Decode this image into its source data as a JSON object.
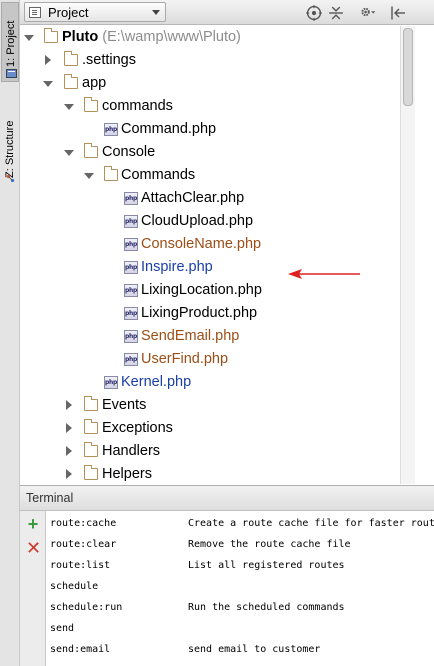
{
  "sidebar": {
    "tabs": [
      {
        "label": "1: Project"
      },
      {
        "label": "Z: Structure"
      }
    ]
  },
  "header": {
    "select_label": "Project",
    "icons": [
      "target-icon",
      "collapse-icon",
      "gear-icon",
      "hide-panel-icon"
    ]
  },
  "tree": {
    "root": {
      "name": "Pluto",
      "path": "(E:\\wamp\\www\\Pluto)"
    },
    "items": [
      {
        "name": ".settings"
      },
      {
        "name": "app"
      },
      {
        "name": "commands"
      },
      {
        "name": "Command.php"
      },
      {
        "name": "Console"
      },
      {
        "name": "Commands"
      },
      {
        "name": "AttachClear.php"
      },
      {
        "name": "CloudUpload.php"
      },
      {
        "name": "ConsoleName.php"
      },
      {
        "name": "Inspire.php"
      },
      {
        "name": "LixingLocation.php"
      },
      {
        "name": "LixingProduct.php"
      },
      {
        "name": "SendEmail.php"
      },
      {
        "name": "UserFind.php"
      },
      {
        "name": "Kernel.php"
      },
      {
        "name": "Events"
      },
      {
        "name": "Exceptions"
      },
      {
        "name": "Handlers"
      },
      {
        "name": "Helpers"
      }
    ]
  },
  "colors": {
    "modified_orange": "#9c4e16",
    "changed_blue": "#1a3fa6",
    "arrow_red": "#e02020"
  },
  "terminal": {
    "title": "Terminal",
    "lines": [
      {
        "cmd": " route:cache",
        "desc": "Create a route cache file for faster route registration"
      },
      {
        "cmd": " route:clear",
        "desc": "Remove the route cache file"
      },
      {
        "cmd": " route:list",
        "desc": "List all registered routes"
      },
      {
        "cmd": "schedule",
        "desc": ""
      },
      {
        "cmd": " schedule:run",
        "desc": "Run the scheduled commands"
      },
      {
        "cmd": "send",
        "desc": ""
      },
      {
        "cmd": " send:email",
        "desc": "send email to customer"
      }
    ]
  }
}
